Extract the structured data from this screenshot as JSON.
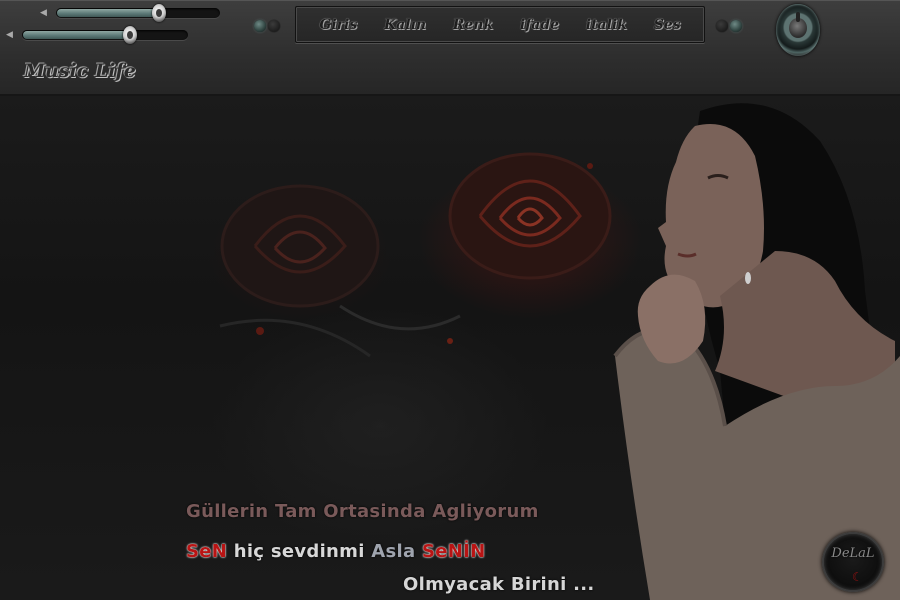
{
  "app": {
    "title": "Music Life"
  },
  "volume": {
    "slider1_level": 0.63,
    "slider2_level": 0.65
  },
  "menu": {
    "items": [
      {
        "id": "giris",
        "label": "Giris"
      },
      {
        "id": "kalin",
        "label": "Kalın"
      },
      {
        "id": "renk",
        "label": "Renk"
      },
      {
        "id": "ifade",
        "label": "ifade"
      },
      {
        "id": "italik",
        "label": "italik"
      },
      {
        "id": "ses",
        "label": "Ses"
      }
    ]
  },
  "lyrics": {
    "line1": "Güllerin Tam Ortasinda Agliyorum",
    "line2": {
      "part1": "SeN",
      "part2": " hiç sevdinmi ",
      "part3": "Asla",
      "part4": " SeNİN"
    },
    "line3": "Olmyacak Birini ..."
  },
  "badge": {
    "text": "DeLaL"
  },
  "colors": {
    "bar_bg": "#2e2e2e",
    "accent_teal": "#6b8683",
    "lyric_red": "#b91414",
    "lyric_muted": "#7a5a5a"
  },
  "icons": {
    "volume": "speaker-icon",
    "power": "power-knob-icon",
    "status": "led-icon"
  }
}
